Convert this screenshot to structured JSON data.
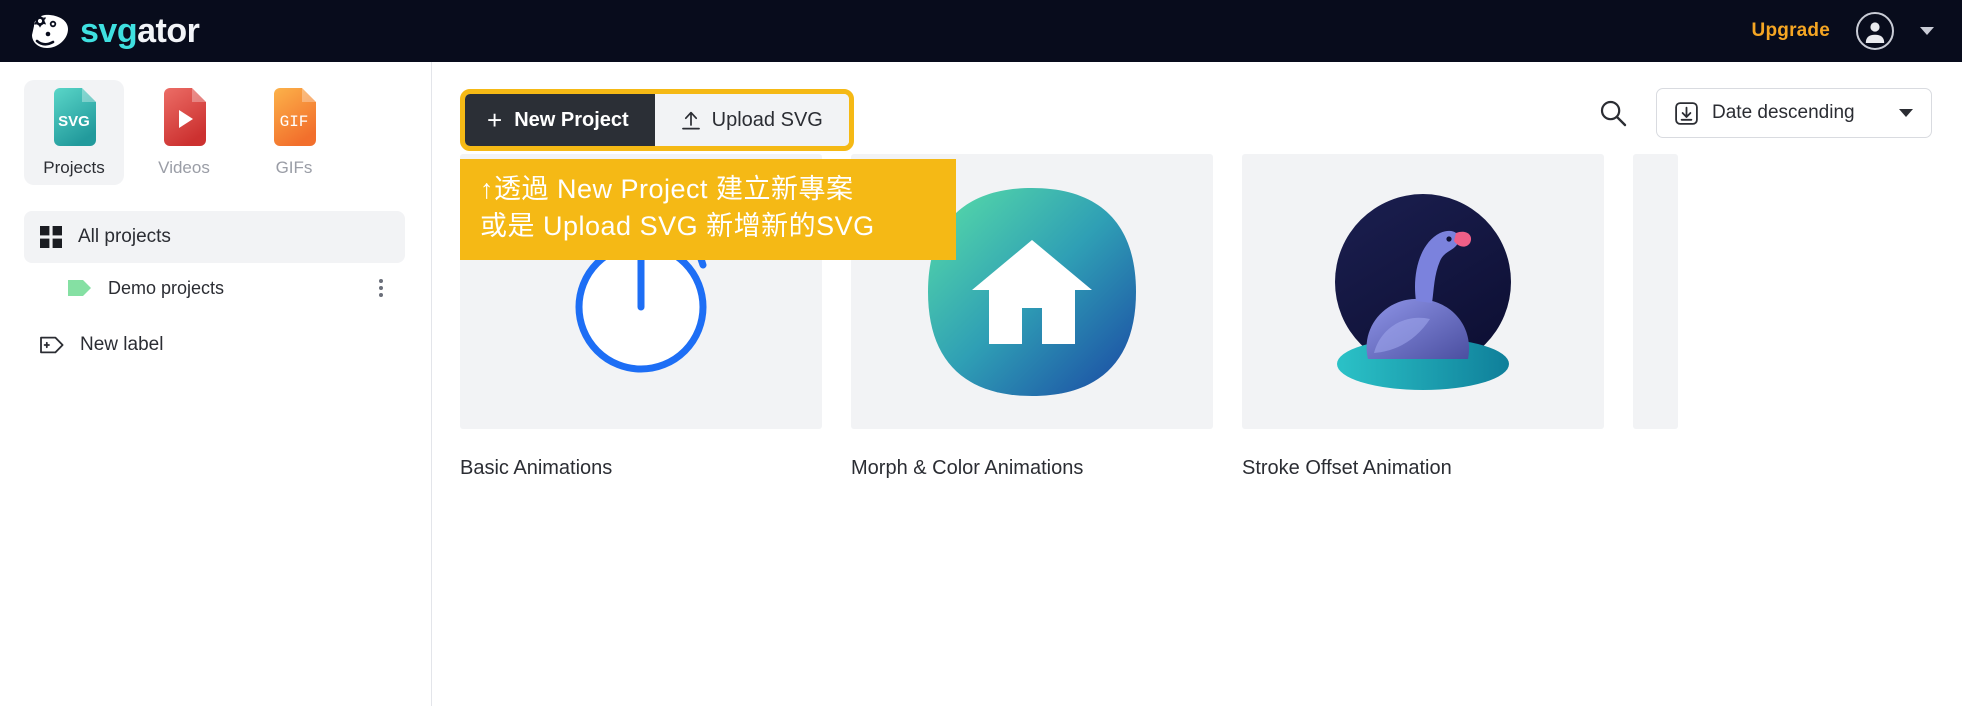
{
  "header": {
    "logo_svg": "svg",
    "logo_ator": "ator",
    "logo_mark_icon": "gator-head-icon",
    "upgrade_label": "Upgrade",
    "avatar_icon": "user-avatar-icon",
    "account_caret_icon": "chevron-down-icon",
    "bg_color": "#080c1c",
    "accent_color": "#f5a623",
    "logo_cyan": "#3fe0e0"
  },
  "sidebar": {
    "filetypes": [
      {
        "label": "Projects",
        "icon": "svg-file-icon",
        "badge": "SVG",
        "active": true,
        "color_from": "#4fd1c5",
        "color_to": "#2a9d9a"
      },
      {
        "label": "Videos",
        "icon": "video-file-icon",
        "badge": "",
        "active": false,
        "color_from": "#e8635f",
        "color_to": "#cf3434"
      },
      {
        "label": "GIFs",
        "icon": "gif-file-icon",
        "badge": "GIF",
        "active": false,
        "color_from": "#fbb040",
        "color_to": "#f2712c"
      }
    ],
    "nav": [
      {
        "label": "All projects",
        "icon": "grid-icon",
        "active": true
      },
      {
        "label": "Demo projects",
        "icon": "label-tag-icon",
        "active": false,
        "tag_color": "#85e0a3",
        "has_menu": true,
        "menu_icon": "kebab-menu-icon"
      }
    ],
    "new_label": {
      "label": "New label",
      "icon": "add-label-icon"
    }
  },
  "toolbar": {
    "new_project_label": "New Project",
    "new_project_plus": "+",
    "upload_svg_label": "Upload SVG",
    "upload_icon": "upload-arrow-icon",
    "search_icon": "search-icon",
    "sort_label": "Date descending",
    "sort_icon": "download-sort-icon",
    "sort_caret_icon": "chevron-down-icon",
    "highlight_color": "#f5b915",
    "new_project_bg": "#2b2f36"
  },
  "annotation": {
    "line1": "↑透過 New Project 建立新專案",
    "line2": "或是 Upload SVG 新增新的SVG",
    "bg_color": "#f5b915",
    "text_color": "#ffffff"
  },
  "projects": [
    {
      "title": "Basic Animations",
      "thumb_icon": "stopwatch-illustration",
      "accent": "#1d6ef5"
    },
    {
      "title": "Morph & Color Animations",
      "thumb_icon": "house-squircle-illustration",
      "accent": "#2bb5a0"
    },
    {
      "title": "Stroke Offset Animation",
      "thumb_icon": "swan-illustration",
      "accent": "#6d7ae0"
    }
  ]
}
